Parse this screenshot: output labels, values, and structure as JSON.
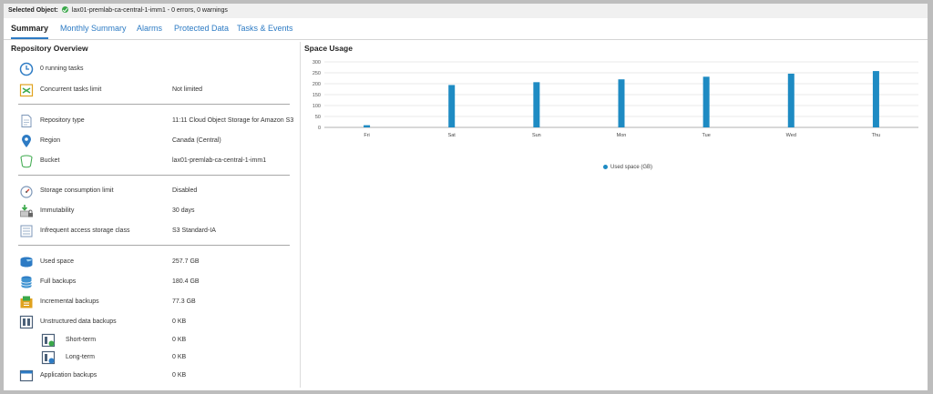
{
  "status": {
    "label": "Selected Object:",
    "text": "lax01-premlab-ca-central-1-imm1 - 0 errors, 0 warnings"
  },
  "tabs": [
    {
      "label": "Summary",
      "active": true
    },
    {
      "label": "Monthly Summary"
    },
    {
      "label": "Alarms"
    },
    {
      "label": "Protected Data"
    },
    {
      "label": "Tasks & Events"
    }
  ],
  "overview": {
    "title": "Repository Overview",
    "running_tasks": "0 running tasks",
    "concurrent_label": "Concurrent tasks limit",
    "concurrent_value": "Not limited",
    "repo_type_label": "Repository type",
    "repo_type_value": "11:11 Cloud Object Storage for Amazon S3",
    "region_label": "Region",
    "region_value": "Canada (Central)",
    "bucket_label": "Bucket",
    "bucket_value": "lax01-premlab-ca-central-1-imm1",
    "storage_limit_label": "Storage consumption limit",
    "storage_limit_value": "Disabled",
    "immutability_label": "Immutability",
    "immutability_value": "30 days",
    "infrequent_label": "Infrequent access storage class",
    "infrequent_value": "S3 Standard-IA",
    "used_label": "Used space",
    "used_value": "257.7 GB",
    "full_label": "Full backups",
    "full_value": "180.4 GB",
    "incr_label": "Incremental backups",
    "incr_value": "77.3 GB",
    "unstruct_label": "Unstructured data backups",
    "unstruct_value": "0 KB",
    "short_label": "Short-term",
    "short_value": "0 KB",
    "long_label": "Long-term",
    "long_value": "0 KB",
    "app_label": "Application backups",
    "app_value": "0 KB"
  },
  "space_usage": {
    "title": "Space Usage"
  },
  "colors": {
    "accent": "#2d7bc4",
    "bar": "#1e8bc3",
    "ok": "#3aa84a"
  },
  "chart_data": {
    "type": "bar",
    "categories": [
      "Fri",
      "Sat",
      "Sun",
      "Mon",
      "Tue",
      "Wed",
      "Thu"
    ],
    "series": [
      {
        "name": "Used space (GB)",
        "values": [
          10,
          194,
          207,
          220,
          232,
          246,
          258
        ]
      }
    ],
    "ylim": [
      0,
      300
    ],
    "yticks": [
      0,
      50,
      100,
      150,
      200,
      250,
      300
    ],
    "grid": true,
    "legend": "bottom"
  }
}
